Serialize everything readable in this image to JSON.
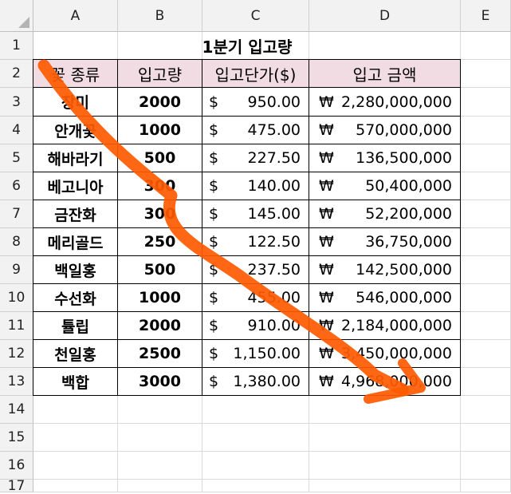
{
  "columns": [
    "A",
    "B",
    "C",
    "D",
    "E"
  ],
  "rows": [
    "1",
    "2",
    "3",
    "4",
    "5",
    "6",
    "7",
    "8",
    "9",
    "10",
    "11",
    "12",
    "13",
    "14",
    "15",
    "16",
    "17"
  ],
  "title": "1분기 입고량",
  "headers": [
    "꽃 종류",
    "입고량",
    "입고단가($)",
    "입고 금액"
  ],
  "currency_dollar": "$",
  "currency_won": "₩",
  "table_rows": [
    {
      "name": "장미",
      "qty": "2000",
      "price": "950.00",
      "amount": "2,280,000,000"
    },
    {
      "name": "안개꽃",
      "qty": "1000",
      "price": "475.00",
      "amount": "570,000,000"
    },
    {
      "name": "해바라기",
      "qty": "500",
      "price": "227.50",
      "amount": "136,500,000"
    },
    {
      "name": "베고니아",
      "qty": "300",
      "price": "140.00",
      "amount": "50,400,000"
    },
    {
      "name": "금잔화",
      "qty": "300",
      "price": "145.00",
      "amount": "52,200,000"
    },
    {
      "name": "메리골드",
      "qty": "250",
      "price": "122.50",
      "amount": "36,750,000"
    },
    {
      "name": "백일홍",
      "qty": "500",
      "price": "237.50",
      "amount": "142,500,000"
    },
    {
      "name": "수선화",
      "qty": "1000",
      "price": "455.00",
      "amount": "546,000,000"
    },
    {
      "name": "튤립",
      "qty": "2000",
      "price": "910.00",
      "amount": "2,184,000,000"
    },
    {
      "name": "천일홍",
      "qty": "2500",
      "price": "1,150.00",
      "amount": "3,450,000,000"
    },
    {
      "name": "백합",
      "qty": "3000",
      "price": "1,380.00",
      "amount": "4,968,000,000"
    }
  ],
  "colors": {
    "header_fill": "#f2dce4",
    "arrow": "#ff5a00"
  }
}
